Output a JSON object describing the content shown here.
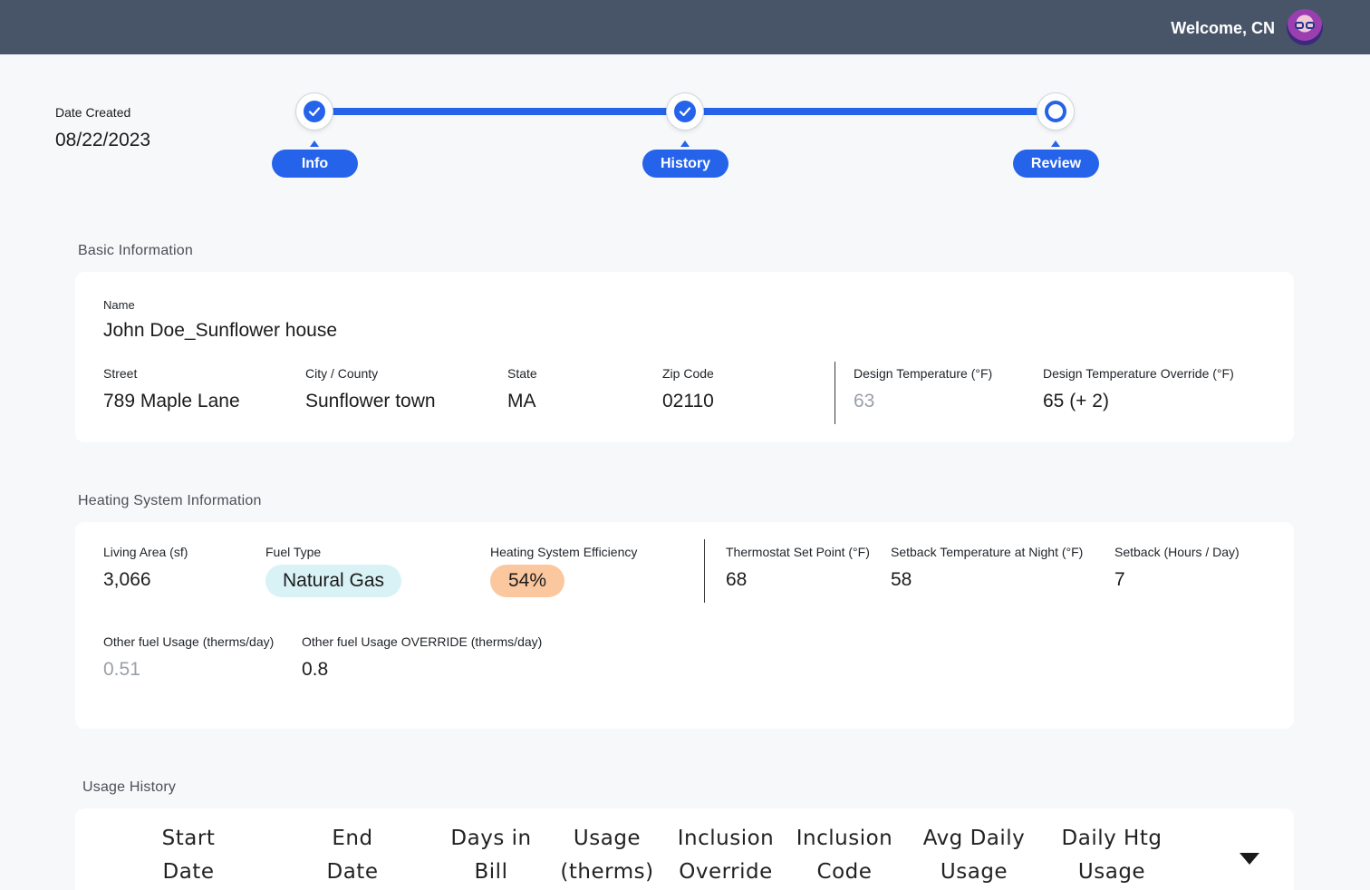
{
  "header": {
    "welcome": "Welcome, CN",
    "avatar_icon": "avatar-icon"
  },
  "date_created": {
    "label": "Date Created",
    "value": "08/22/2023"
  },
  "stepper": {
    "steps": [
      {
        "label": "Info",
        "state": "complete"
      },
      {
        "label": "History",
        "state": "complete"
      },
      {
        "label": "Review",
        "state": "current"
      }
    ],
    "accent": "#2563eb"
  },
  "basic": {
    "title": "Basic Information",
    "name_label": "Name",
    "name_value": "John Doe_Sunflower house",
    "street_label": "Street",
    "street_value": "789 Maple Lane",
    "city_label": "City / County",
    "city_value": "Sunflower town",
    "state_label": "State",
    "state_value": "MA",
    "zip_label": "Zip Code",
    "zip_value": "02110",
    "design_temp_label": "Design Temperature (°F)",
    "design_temp_value": "63",
    "design_override_label": "Design Temperature Override (°F)",
    "design_override_value": "65  (+ 2)"
  },
  "heating": {
    "title": "Heating System Information",
    "living_area_label": "Living Area (sf)",
    "living_area_value": "3,066",
    "fuel_type_label": "Fuel Type",
    "fuel_type_value": "Natural Gas",
    "efficiency_label": "Heating System Efficiency",
    "efficiency_value": "54%",
    "thermostat_label": "Thermostat Set Point (°F)",
    "thermostat_value": "68",
    "setback_temp_label": "Setback Temperature at Night (°F)",
    "setback_temp_value": "58",
    "setback_hours_label": "Setback (Hours / Day)",
    "setback_hours_value": "7",
    "other_fuel_label": "Other fuel Usage  (therms/day)",
    "other_fuel_value": "0.51",
    "other_fuel_override_label": "Other fuel Usage OVERRIDE (therms/day)",
    "other_fuel_override_value": "0.8",
    "colors": {
      "fuel_pill": "#d9f2f6",
      "efficiency_pill": "#fbc79e"
    }
  },
  "usage": {
    "title": "Usage History",
    "columns": [
      {
        "line1": "Start",
        "line2": "Date"
      },
      {
        "line1": "End",
        "line2": "Date"
      },
      {
        "line1": "Days in",
        "line2": "Bill"
      },
      {
        "line1": "Usage",
        "line2": "(therms)"
      },
      {
        "line1": "Inclusion",
        "line2": "Override"
      },
      {
        "line1": "Inclusion",
        "line2": "Code"
      },
      {
        "line1": "Avg Daily",
        "line2": "Usage"
      },
      {
        "line1": "Daily Htg",
        "line2": "Usage"
      }
    ],
    "toggle_icon": "triangle-down-icon"
  }
}
